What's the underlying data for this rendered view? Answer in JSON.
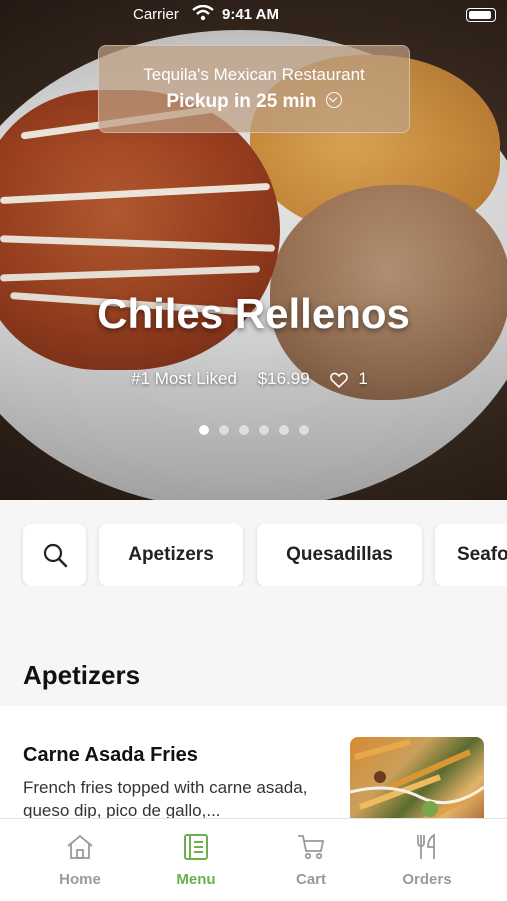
{
  "status": {
    "carrier": "Carrier",
    "time": "9:41 AM"
  },
  "pickup": {
    "restaurant": "Tequila's Mexican Restaurant",
    "time_text": "Pickup in 25 min"
  },
  "hero": {
    "title": "Chiles Rellenos",
    "rank": "#1 Most Liked",
    "price": "$16.99",
    "likes": "1",
    "slide_count": 6,
    "active_slide": 1
  },
  "categories": [
    {
      "label": "Apetizers"
    },
    {
      "label": "Quesadillas"
    },
    {
      "label": "Seafood"
    }
  ],
  "section": {
    "title": "Apetizers"
  },
  "item": {
    "name": "Carne Asada Fries",
    "description": "French fries topped with carne asada, queso dip, pico de gallo,..."
  },
  "tabs": [
    {
      "label": "Home",
      "icon": "home-icon"
    },
    {
      "label": "Menu",
      "icon": "menu-book-icon",
      "active": true
    },
    {
      "label": "Cart",
      "icon": "cart-icon"
    },
    {
      "label": "Orders",
      "icon": "fork-knife-icon"
    }
  ],
  "colors": {
    "accent": "#6ab04c",
    "inactive": "#9a9a9a"
  }
}
